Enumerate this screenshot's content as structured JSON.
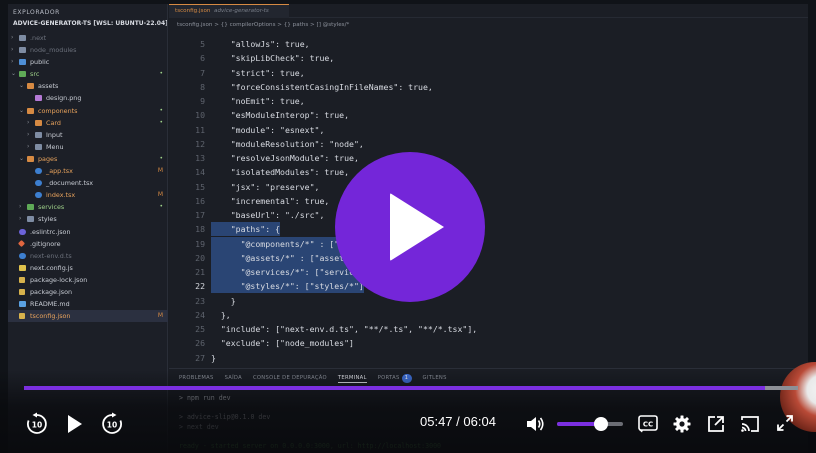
{
  "explorer": {
    "title": "EXPLORADOR",
    "project": "ADVICE-GENERATOR-TS [WSL: UBUNTU-22.04]",
    "items": [
      {
        "label": ".next",
        "type": "folder",
        "level": 0,
        "state": "dim",
        "icon": "folder-icon"
      },
      {
        "label": "node_modules",
        "type": "folder",
        "level": 0,
        "state": "dim",
        "icon": "folder-icon"
      },
      {
        "label": "public",
        "type": "folder",
        "level": 0,
        "state": "normal",
        "icon": "folder-blue-icon"
      },
      {
        "label": "src",
        "type": "folder-open",
        "level": 0,
        "state": "green",
        "icon": "folder-green-icon",
        "badge": "•"
      },
      {
        "label": "assets",
        "type": "folder-open",
        "level": 1,
        "state": "normal",
        "icon": "folder-orange-icon"
      },
      {
        "label": "design.png",
        "type": "file",
        "level": 2,
        "state": "normal",
        "icon": "image-file-icon"
      },
      {
        "label": "components",
        "type": "folder-open",
        "level": 1,
        "state": "orange",
        "icon": "folder-orange-icon",
        "badge": "•"
      },
      {
        "label": "Card",
        "type": "folder",
        "level": 2,
        "state": "orange",
        "icon": "folder-orange-icon",
        "badge": "•"
      },
      {
        "label": "Input",
        "type": "folder",
        "level": 2,
        "state": "normal",
        "icon": "folder-icon"
      },
      {
        "label": "Menu",
        "type": "folder",
        "level": 2,
        "state": "normal",
        "icon": "folder-icon"
      },
      {
        "label": "pages",
        "type": "folder-open",
        "level": 1,
        "state": "orange",
        "icon": "folder-orange-icon",
        "badge": "•"
      },
      {
        "label": "_app.tsx",
        "type": "file",
        "level": 2,
        "state": "orange",
        "icon": "typescript-file-icon",
        "badge": "M"
      },
      {
        "label": "_document.tsx",
        "type": "file",
        "level": 2,
        "state": "normal",
        "icon": "typescript-file-icon"
      },
      {
        "label": "index.tsx",
        "type": "file",
        "level": 2,
        "state": "orange",
        "icon": "typescript-file-icon",
        "badge": "M"
      },
      {
        "label": "services",
        "type": "folder",
        "level": 1,
        "state": "green",
        "icon": "folder-green-icon",
        "badge": "•"
      },
      {
        "label": "styles",
        "type": "folder",
        "level": 1,
        "state": "normal",
        "icon": "folder-icon"
      },
      {
        "label": ".eslintrc.json",
        "type": "file",
        "level": 0,
        "state": "normal",
        "icon": "eslint-file-icon"
      },
      {
        "label": ".gitignore",
        "type": "file",
        "level": 0,
        "state": "normal",
        "icon": "git-file-icon"
      },
      {
        "label": "next-env.d.ts",
        "type": "file",
        "level": 0,
        "state": "dim",
        "icon": "typescript-file-icon"
      },
      {
        "label": "next.config.js",
        "type": "file",
        "level": 0,
        "state": "normal",
        "icon": "js-file-icon"
      },
      {
        "label": "package-lock.json",
        "type": "file",
        "level": 0,
        "state": "normal",
        "icon": "json-file-icon"
      },
      {
        "label": "package.json",
        "type": "file",
        "level": 0,
        "state": "normal",
        "icon": "json-file-icon"
      },
      {
        "label": "README.md",
        "type": "file",
        "level": 0,
        "state": "normal",
        "icon": "markdown-file-icon"
      },
      {
        "label": "tsconfig.json",
        "type": "file",
        "level": 0,
        "state": "selected",
        "icon": "json-file-icon",
        "badge": "M"
      }
    ]
  },
  "editor": {
    "tab": {
      "name": "tsconfig.json",
      "path": "advice-generator-ts"
    },
    "breadcrumb": "tsconfig.json  >  {} compilerOptions  >  {} paths  >  [] @styles/*",
    "lines": [
      {
        "num": "5",
        "text": "    \"allowJs\": true,"
      },
      {
        "num": "6",
        "text": "    \"skipLibCheck\": true,"
      },
      {
        "num": "7",
        "text": "    \"strict\": true,"
      },
      {
        "num": "8",
        "text": "    \"forceConsistentCasingInFileNames\": true,"
      },
      {
        "num": "9",
        "text": "    \"noEmit\": true,"
      },
      {
        "num": "10",
        "text": "    \"esModuleInterop\": true,"
      },
      {
        "num": "11",
        "text": "    \"module\": \"esnext\","
      },
      {
        "num": "12",
        "text": "    \"moduleResolution\": \"node\","
      },
      {
        "num": "13",
        "text": "    \"resolveJsonModule\": true,"
      },
      {
        "num": "14",
        "text": "    \"isolatedModules\": true,"
      },
      {
        "num": "15",
        "text": "    \"jsx\": \"preserve\","
      },
      {
        "num": "16",
        "text": "    \"incremental\": true,"
      },
      {
        "num": "17",
        "text": "    \"baseUrl\": \"./src\","
      },
      {
        "num": "18",
        "text": "    \"paths\": {"
      },
      {
        "num": "19",
        "text": "      \"@components/*\" : [\"components/*\"],"
      },
      {
        "num": "20",
        "text": "      \"@assets/*\" : [\"assets/*\"],"
      },
      {
        "num": "21",
        "text": "      \"@services/*\": [\"services/*\"],"
      },
      {
        "num": "22",
        "text": "      \"@styles/*\": [\"styles/*\"]"
      },
      {
        "num": "23",
        "text": "    }"
      },
      {
        "num": "24",
        "text": "  },"
      },
      {
        "num": "25",
        "text": "  \"include\": [\"next-env.d.ts\", \"**/*.ts\", \"**/*.tsx\"],"
      },
      {
        "num": "26",
        "text": "  \"exclude\": [\"node_modules\"]"
      },
      {
        "num": "27",
        "text": "}"
      }
    ],
    "active_line": "22"
  },
  "panel": {
    "tabs": [
      "PROBLEMAS",
      "SAÍDA",
      "CONSOLE DE DEPURAÇÃO",
      "TERMINAL",
      "PORTAS",
      "GITLENS"
    ],
    "active_tab": "TERMINAL",
    "ports_count": "1",
    "terminal": [
      "> npm run dev",
      "",
      "> advice-slip@0.1.0 dev",
      "> next dev",
      "",
      "ready - started server on 0.0.0.0:3000, url: http://localhost:3000"
    ]
  },
  "player": {
    "current_time": "05:47",
    "separator": "/",
    "duration": "06:04",
    "progress": 0.958,
    "volume": 0.66,
    "accent_color": "#7426d9",
    "icons": [
      "rewind-10-icon",
      "play-icon",
      "forward-10-icon",
      "volume-icon",
      "captions-icon",
      "settings-icon",
      "popout-icon",
      "cast-icon",
      "fullscreen-icon"
    ]
  }
}
